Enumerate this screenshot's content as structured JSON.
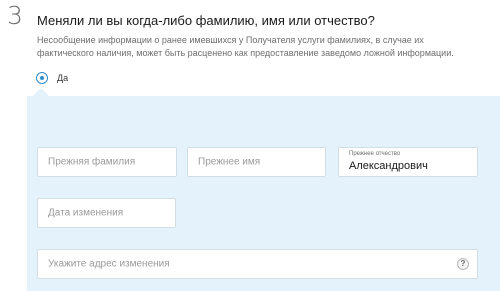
{
  "step": {
    "number": "3"
  },
  "question": {
    "title": "Меняли ли вы когда-либо фамилию, имя или отчество?",
    "note": "Несообщение информации о ранее имевшихся у Получателя услуги фамилиях, в случае их фактического наличия, может быть расценено как предоставление заведомо ложной информации."
  },
  "radio": {
    "label": "Да",
    "selected": true
  },
  "fields": {
    "former_surname": {
      "placeholder": "Прежняя фамилия",
      "value": ""
    },
    "former_name": {
      "placeholder": "Прежнее имя",
      "value": ""
    },
    "former_patronymic": {
      "label": "Прежнее отчество",
      "value": "Александрович"
    },
    "change_date": {
      "placeholder": "Дата изменения",
      "value": ""
    },
    "change_address": {
      "placeholder": "Укажите адрес изменения",
      "value": "",
      "help": "?"
    }
  },
  "colors": {
    "accent": "#2f8fd0",
    "panel_bg": "#e4f3fb",
    "field_border": "#d3dde4"
  }
}
